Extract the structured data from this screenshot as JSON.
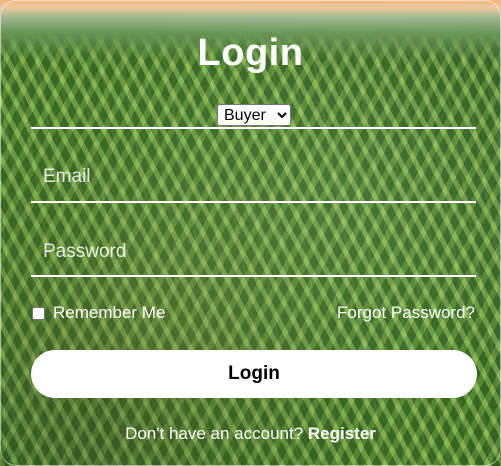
{
  "title": "Login",
  "role_select": {
    "selected": "Buyer"
  },
  "email": {
    "placeholder": "Email",
    "value": ""
  },
  "password": {
    "placeholder": "Password",
    "value": ""
  },
  "remember": {
    "label": "Remember Me",
    "checked": false
  },
  "forgot_link": "Forgot Password?",
  "login_button": "Login",
  "register": {
    "prompt": "Don't have an account?",
    "link": "Register"
  }
}
